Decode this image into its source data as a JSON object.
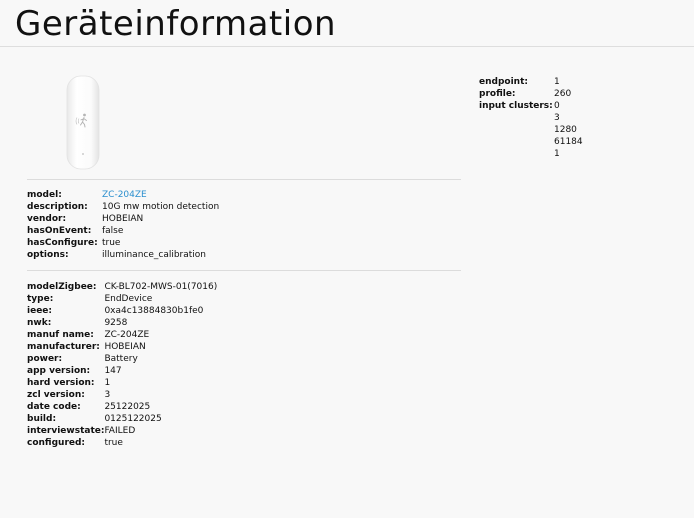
{
  "header": {
    "title": "Geräteinformation"
  },
  "device": {
    "image_icon": "motion-sensor-icon",
    "rows": [
      {
        "key": "model:",
        "value": "ZC-204ZE"
      },
      {
        "key": "description:",
        "value": "10G mw motion detection"
      },
      {
        "key": "vendor:",
        "value": "HOBEIAN"
      },
      {
        "key": "hasOnEvent:",
        "value": "false"
      },
      {
        "key": "hasConfigure:",
        "value": "true"
      },
      {
        "key": "options:",
        "value": "illuminance_calibration"
      }
    ]
  },
  "zigbee": {
    "rows": [
      {
        "key": "modelZigbee:",
        "value": "CK-BL702-MWS-01(7016)"
      },
      {
        "key": "type:",
        "value": "EndDevice"
      },
      {
        "key": "ieee:",
        "value": "0xa4c13884830b1fe0"
      },
      {
        "key": "nwk:",
        "value": "9258"
      },
      {
        "key": "manuf name:",
        "value": "ZC-204ZE"
      },
      {
        "key": "manufacturer:",
        "value": "HOBEIAN"
      },
      {
        "key": "power:",
        "value": "Battery"
      },
      {
        "key": "app version:",
        "value": "147"
      },
      {
        "key": "hard version:",
        "value": "1"
      },
      {
        "key": "zcl version:",
        "value": "3"
      },
      {
        "key": "date code:",
        "value": "25122025"
      },
      {
        "key": "build:",
        "value": "0125122025"
      },
      {
        "key": "interviewstate:",
        "value": "FAILED"
      },
      {
        "key": "configured:",
        "value": "true"
      }
    ]
  },
  "endpoint": {
    "endpoint_label": "endpoint:",
    "endpoint_value": "1",
    "profile_label": "profile:",
    "profile_value": "260",
    "input_clusters_label": "input clusters:",
    "input_clusters": [
      "0",
      "3",
      "1280",
      "61184",
      "1"
    ]
  },
  "colors": {
    "link": "#2b8fce",
    "background": "#f8f8f8",
    "divider": "#dcdcdc"
  }
}
